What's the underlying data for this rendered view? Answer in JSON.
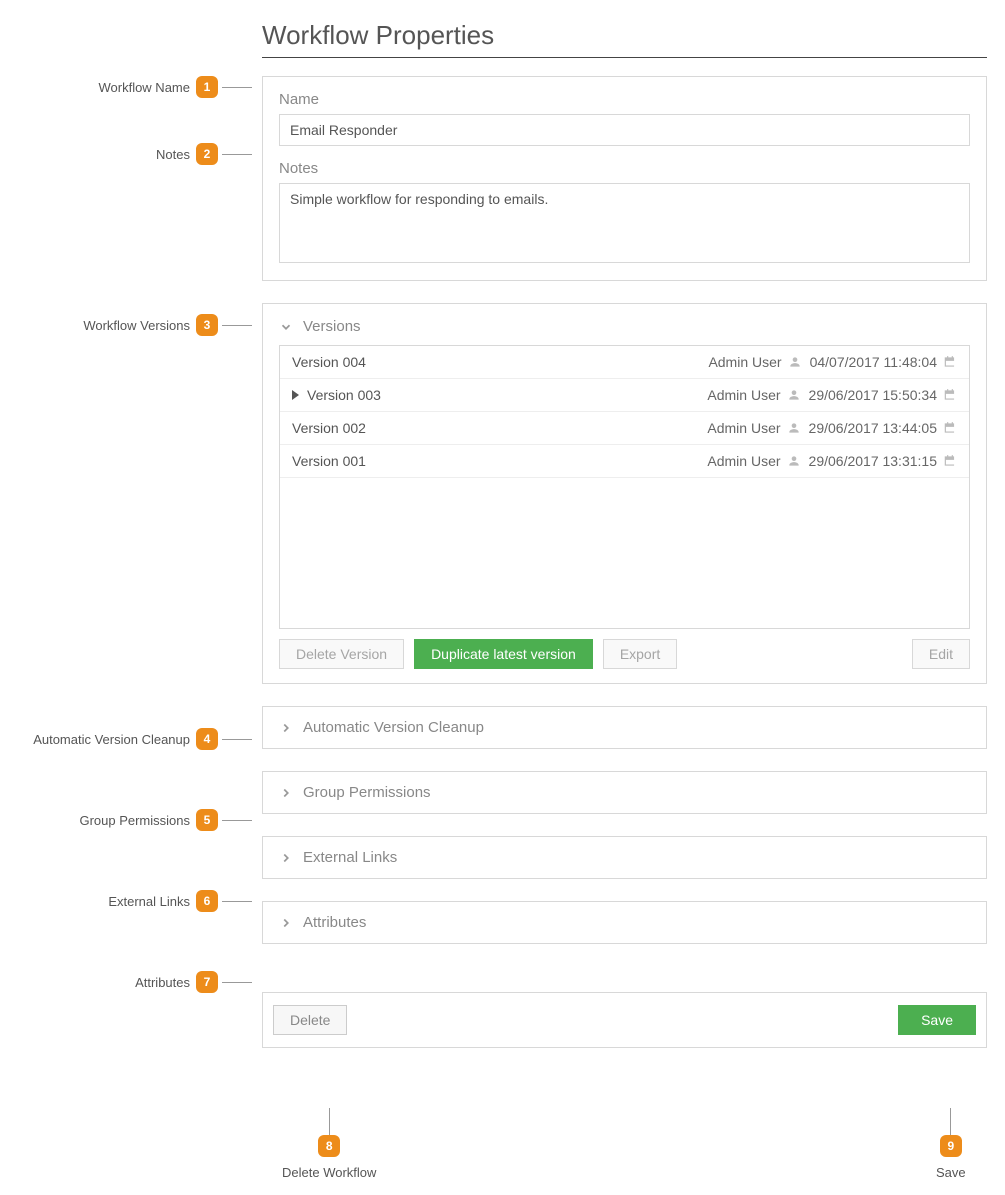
{
  "page": {
    "title": "Workflow Properties"
  },
  "callouts": {
    "c1": {
      "num": "1",
      "label": "Workflow Name"
    },
    "c2": {
      "num": "2",
      "label": "Notes"
    },
    "c3": {
      "num": "3",
      "label": "Workflow Versions"
    },
    "c4": {
      "num": "4",
      "label": "Automatic Version Cleanup"
    },
    "c5": {
      "num": "5",
      "label": "Group Permissions"
    },
    "c6": {
      "num": "6",
      "label": "External Links"
    },
    "c7": {
      "num": "7",
      "label": "Attributes"
    },
    "c8": {
      "num": "8",
      "label": "Delete Workflow"
    },
    "c9": {
      "num": "9",
      "label": "Save"
    }
  },
  "name": {
    "label": "Name",
    "value": "Email Responder"
  },
  "notes": {
    "label": "Notes",
    "value": "Simple workflow for responding to emails."
  },
  "versions": {
    "header": "Versions",
    "rows": [
      {
        "name": "Version 004",
        "user": "Admin User",
        "date": "04/07/2017 11:48:04",
        "current": false
      },
      {
        "name": "Version 003",
        "user": "Admin User",
        "date": "29/06/2017 15:50:34",
        "current": true
      },
      {
        "name": "Version 002",
        "user": "Admin User",
        "date": "29/06/2017 13:44:05",
        "current": false
      },
      {
        "name": "Version 001",
        "user": "Admin User",
        "date": "29/06/2017 13:31:15",
        "current": false
      }
    ],
    "buttons": {
      "delete_version": "Delete Version",
      "duplicate": "Duplicate latest version",
      "export": "Export",
      "edit": "Edit"
    }
  },
  "sections": {
    "cleanup": "Automatic Version Cleanup",
    "permissions": "Group Permissions",
    "external": "External Links",
    "attributes": "Attributes"
  },
  "footer": {
    "delete": "Delete",
    "save": "Save"
  }
}
